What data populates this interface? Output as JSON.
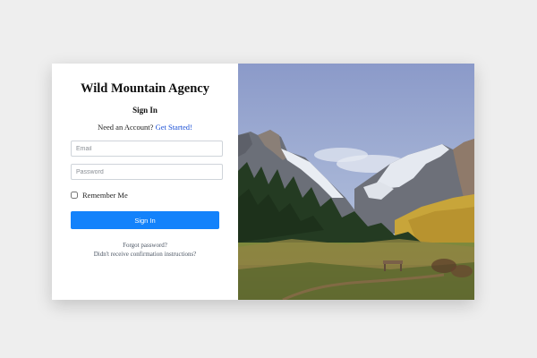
{
  "brand": {
    "name": "Wild Mountain Agency"
  },
  "form": {
    "heading": "Sign In",
    "need_account_text": "Need an Account?",
    "get_started_link": "Get Started!",
    "email_placeholder": "Email",
    "email_value": "",
    "password_placeholder": "Password",
    "password_value": "",
    "remember_label": "Remember Me",
    "remember_checked": false,
    "submit_label": "Sign In",
    "forgot_password_link": "Forgot password?",
    "confirmation_link": "Didn't receive confirmation instructions?"
  },
  "hero_image": {
    "icon": "mountain-landscape-image"
  },
  "colors": {
    "accent": "#1382fb",
    "link": "#1a4fd6",
    "background": "#eeeeee"
  }
}
